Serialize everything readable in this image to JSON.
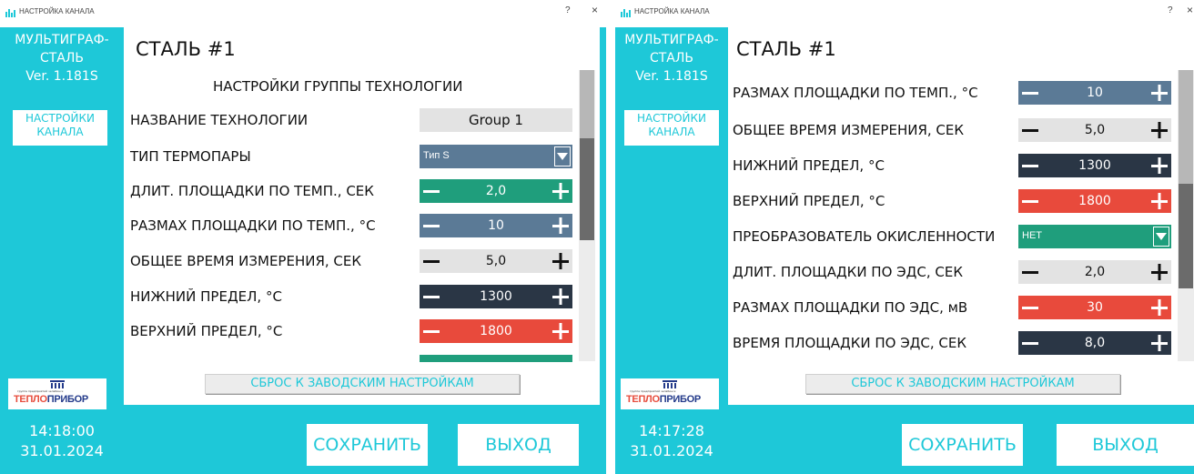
{
  "left": {
    "window_title": "НАСТРОЙКА КАНАЛА",
    "help": "?",
    "close": "×",
    "sidebar": {
      "app_name": [
        "МУЛЬТИГРАФ-",
        "СТАЛЬ",
        "Ver. 1.181S"
      ],
      "nav_button": [
        "НАСТРОЙКИ",
        "КАНАЛА"
      ]
    },
    "logo": {
      "subtitle": "группа предприятий  челябинск",
      "part1": "ТЕПЛО",
      "part2": "ПРИБОР"
    },
    "clock": {
      "time": "14:18:00",
      "date": "31.01.2024"
    },
    "main_title": "СТАЛЬ #1",
    "section_title": "НАСТРОЙКИ ГРУППЫ ТЕХНОЛОГИИ",
    "rows": [
      {
        "label": "НАЗВАНИЕ ТЕХНОЛОГИИ",
        "value": "Group 1"
      },
      {
        "label": "ТИП ТЕРМОПАРЫ",
        "value": "Тип S"
      },
      {
        "label": "ДЛИТ. ПЛОЩАДКИ ПО ТЕМП., СЕК",
        "value": "2,0"
      },
      {
        "label": "РАЗМАХ ПЛОЩАДКИ ПО ТЕМП., °C",
        "value": "10"
      },
      {
        "label": "ОБЩЕЕ ВРЕМЯ ИЗМЕРЕНИЯ, СЕК",
        "value": "5,0"
      },
      {
        "label": "НИЖНИЙ ПРЕДЕЛ, °C",
        "value": "1300"
      },
      {
        "label": "ВЕРХНИЙ ПРЕДЕЛ, °C",
        "value": "1800"
      }
    ],
    "reset_label": "СБРОС К ЗАВОДСКИМ НАСТРОЙКАМ",
    "save_label": "СОХРАНИТЬ",
    "exit_label": "ВЫХОД"
  },
  "right": {
    "window_title": "НАСТРОЙКА КАНАЛА",
    "help": "?",
    "close": "×",
    "sidebar": {
      "app_name": [
        "МУЛЬТИГРАФ-",
        "СТАЛЬ",
        "Ver. 1.181S"
      ],
      "nav_button": [
        "НАСТРОЙКИ",
        "КАНАЛА"
      ]
    },
    "logo": {
      "subtitle": "группа предприятий  челябинск",
      "part1": "ТЕПЛО",
      "part2": "ПРИБОР"
    },
    "clock": {
      "time": "14:17:28",
      "date": "31.01.2024"
    },
    "main_title": "СТАЛЬ #1",
    "rows": [
      {
        "label": "РАЗМАХ ПЛОЩАДКИ ПО ТЕМП., °C",
        "value": "10"
      },
      {
        "label": "ОБЩЕЕ ВРЕМЯ ИЗМЕРЕНИЯ, СЕК",
        "value": "5,0"
      },
      {
        "label": "НИЖНИЙ ПРЕДЕЛ, °C",
        "value": "1300"
      },
      {
        "label": "ВЕРХНИЙ ПРЕДЕЛ, °C",
        "value": "1800"
      },
      {
        "label": "ПРЕОБРАЗОВАТЕЛЬ ОКИСЛЕННОСТИ",
        "value": "НЕТ"
      },
      {
        "label": "ДЛИТ. ПЛОЩАДКИ ПО ЭДС, СЕК",
        "value": "2,0"
      },
      {
        "label": "РАЗМАХ ПЛОЩАДКИ ПО ЭДС, мВ",
        "value": "30"
      },
      {
        "label": "ВРЕМЯ ПЛОЩАДКИ ПО ЭДС, СЕК",
        "value": "8,0"
      }
    ],
    "reset_label": "СБРОС К ЗАВОДСКИМ НАСТРОЙКАМ",
    "save_label": "СОХРАНИТЬ",
    "exit_label": "ВЫХОД"
  },
  "colors": {
    "accent": "#1ec8d8",
    "green": "#1f9e7c",
    "slate": "#5b7a96",
    "light": "#e3e3e3",
    "dark": "#2a3645",
    "red": "#e84a3c"
  }
}
